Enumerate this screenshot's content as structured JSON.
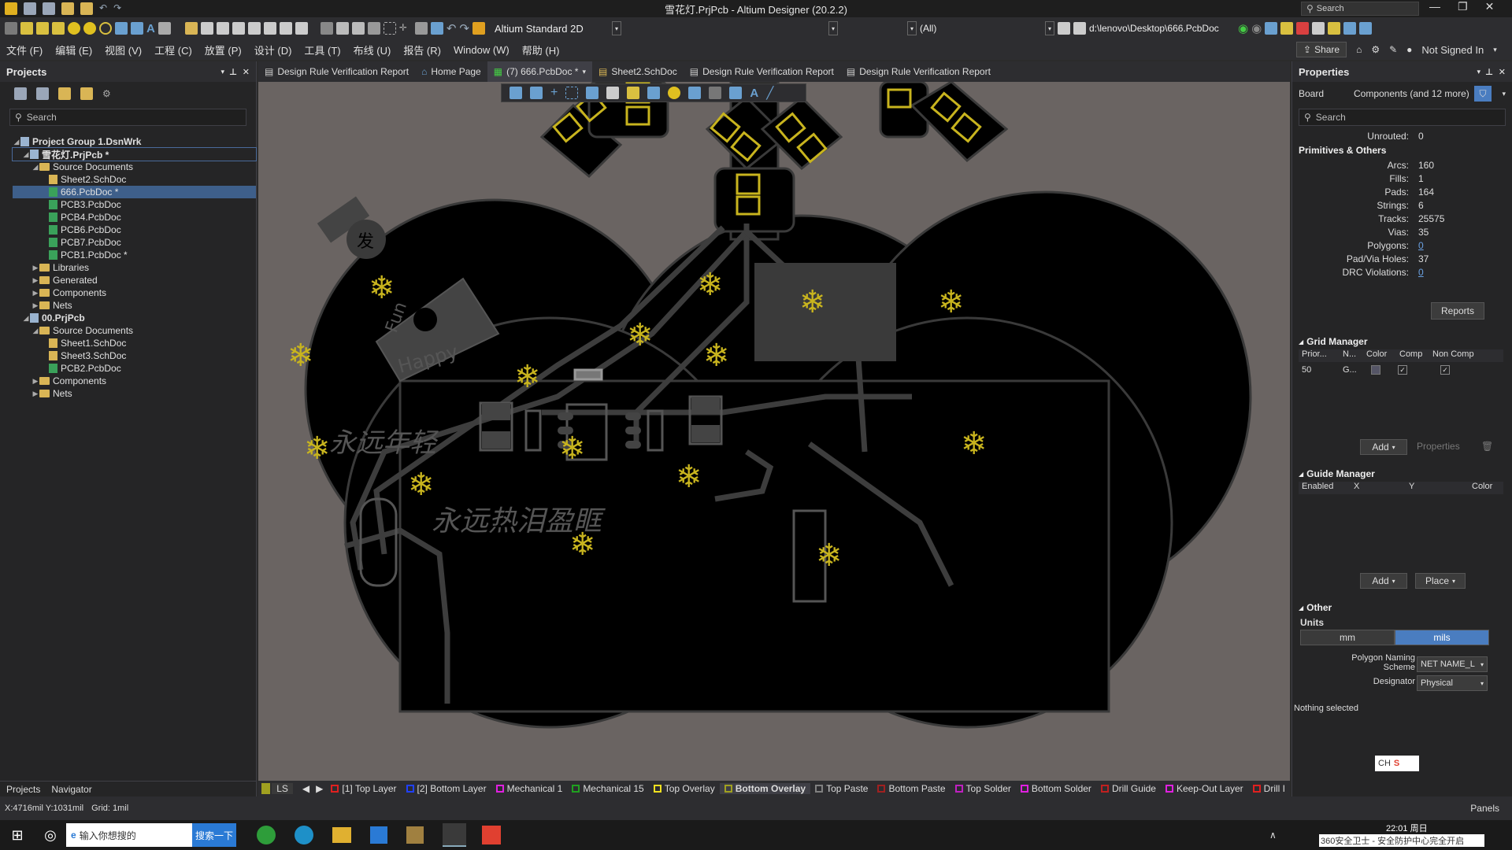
{
  "window": {
    "title": "雪花灯.PrjPcb - Altium Designer (20.2.2)",
    "search_placeholder": "Search"
  },
  "toolbar": {
    "view_mode": "Altium Standard 2D",
    "filter_value": "(All)",
    "path": "d:\\lenovo\\Desktop\\666.PcbDoc"
  },
  "menu": {
    "items": [
      "文件 (F)",
      "编辑 (E)",
      "视图 (V)",
      "工程 (C)",
      "放置 (P)",
      "设计 (D)",
      "工具 (T)",
      "布线 (U)",
      "报告 (R)",
      "Window (W)",
      "帮助 (H)"
    ],
    "share": "Share",
    "signin": "Not Signed In"
  },
  "projects": {
    "title": "Projects",
    "search": "Search",
    "tree": [
      {
        "label": "Project Group 1.DsnWrk",
        "level": 0,
        "kind": "group"
      },
      {
        "label": "雪花灯.PrjPcb *",
        "level": 1,
        "kind": "project",
        "selected_outline": true
      },
      {
        "label": "Source Documents",
        "level": 2,
        "kind": "folder"
      },
      {
        "label": "Sheet2.SchDoc",
        "level": 3,
        "kind": "sch"
      },
      {
        "label": "666.PcbDoc *",
        "level": 3,
        "kind": "pcb",
        "selected": true
      },
      {
        "label": "PCB3.PcbDoc",
        "level": 3,
        "kind": "pcb"
      },
      {
        "label": "PCB4.PcbDoc",
        "level": 3,
        "kind": "pcb"
      },
      {
        "label": "PCB6.PcbDoc",
        "level": 3,
        "kind": "pcb"
      },
      {
        "label": "PCB7.PcbDoc",
        "level": 3,
        "kind": "pcb"
      },
      {
        "label": "PCB1.PcbDoc *",
        "level": 3,
        "kind": "pcb"
      },
      {
        "label": "Libraries",
        "level": 2,
        "kind": "folder"
      },
      {
        "label": "Generated",
        "level": 2,
        "kind": "folder"
      },
      {
        "label": "Components",
        "level": 2,
        "kind": "folder"
      },
      {
        "label": "Nets",
        "level": 2,
        "kind": "folder"
      },
      {
        "label": "00.PrjPcb",
        "level": 1,
        "kind": "project"
      },
      {
        "label": "Source Documents",
        "level": 2,
        "kind": "folder"
      },
      {
        "label": "Sheet1.SchDoc",
        "level": 3,
        "kind": "sch"
      },
      {
        "label": "Sheet3.SchDoc",
        "level": 3,
        "kind": "sch"
      },
      {
        "label": "PCB2.PcbDoc",
        "level": 3,
        "kind": "pcb"
      },
      {
        "label": "Components",
        "level": 2,
        "kind": "folder"
      },
      {
        "label": "Nets",
        "level": 2,
        "kind": "folder"
      }
    ],
    "bottom_tabs": [
      "Projects",
      "Navigator"
    ]
  },
  "doc_tabs": [
    {
      "label": "Design Rule Verification Report"
    },
    {
      "label": "Home Page"
    },
    {
      "label": "(7) 666.PcbDoc *",
      "active": true
    },
    {
      "label": "Sheet2.SchDoc"
    },
    {
      "label": "Design Rule Verification Report"
    },
    {
      "label": "Design Rule Verification Report"
    }
  ],
  "pcb": {
    "silk_texts": [
      "Fun",
      "Happy",
      "永远年轻",
      "永远热泪盈眶"
    ],
    "logo_text": "发"
  },
  "layers": {
    "ls": "LS",
    "items": [
      {
        "label": "[1] Top Layer",
        "color": "#e02020"
      },
      {
        "label": "[2] Bottom Layer",
        "color": "#2040ff"
      },
      {
        "label": "Mechanical 1",
        "color": "#e020e0"
      },
      {
        "label": "Mechanical 15",
        "color": "#20a020"
      },
      {
        "label": "Top Overlay",
        "color": "#f0e020"
      },
      {
        "label": "Bottom Overlay",
        "color": "#a0a020",
        "active": true
      },
      {
        "label": "Top Paste",
        "color": "#808080"
      },
      {
        "label": "Bottom Paste",
        "color": "#a02020"
      },
      {
        "label": "Top Solder",
        "color": "#c020c0"
      },
      {
        "label": "Bottom Solder",
        "color": "#e020e0"
      },
      {
        "label": "Drill Guide",
        "color": "#c02020"
      },
      {
        "label": "Keep-Out Layer",
        "color": "#e020e0"
      },
      {
        "label": "Drill I",
        "color": "#e02020"
      }
    ]
  },
  "properties": {
    "title": "Properties",
    "board_label": "Board",
    "filter_label": "Components (and 12 more)",
    "search": "Search",
    "unrouted_label": "Unrouted:",
    "unrouted": "0",
    "primitives_title": "Primitives & Others",
    "rows": [
      {
        "k": "Arcs:",
        "v": "160"
      },
      {
        "k": "Fills:",
        "v": "1"
      },
      {
        "k": "Pads:",
        "v": "164"
      },
      {
        "k": "Strings:",
        "v": "6"
      },
      {
        "k": "Tracks:",
        "v": "25575"
      },
      {
        "k": "Vias:",
        "v": "35"
      },
      {
        "k": "Polygons:",
        "v": "0",
        "link": true
      },
      {
        "k": "Pad/Via Holes:",
        "v": "37"
      },
      {
        "k": "DRC Violations:",
        "v": "0",
        "link": true
      }
    ],
    "reports_button": "Reports",
    "grid_manager": {
      "title": "Grid Manager",
      "headers": [
        "Prior...",
        "N...",
        "Color",
        "Comp",
        "Non Comp"
      ],
      "row": {
        "priority": "50",
        "name": "G..."
      },
      "add": "Add",
      "properties": "Properties"
    },
    "guide_manager": {
      "title": "Guide Manager",
      "headers": [
        "Enabled",
        "X",
        "Y",
        "Color"
      ],
      "add": "Add",
      "place": "Place"
    },
    "other": {
      "title": "Other",
      "units_label": "Units",
      "unit_mm": "mm",
      "unit_mils": "mils",
      "poly_label": "Polygon Naming Scheme",
      "poly_value": "NET NAME_L",
      "designator_label": "Designator",
      "designator_value": "Physical"
    },
    "nothing_selected": "Nothing selected",
    "panels_button": "Panels"
  },
  "status": {
    "coords": "X:4716mil Y:1031mil",
    "grid": "Grid: 1mil"
  },
  "taskbar": {
    "search_placeholder": "输入你想搜的",
    "search_button": "搜索一下",
    "time": "22:01 周日",
    "notice": "360安全卫士 - 安全防护中心完全开启",
    "ime": "CH"
  }
}
